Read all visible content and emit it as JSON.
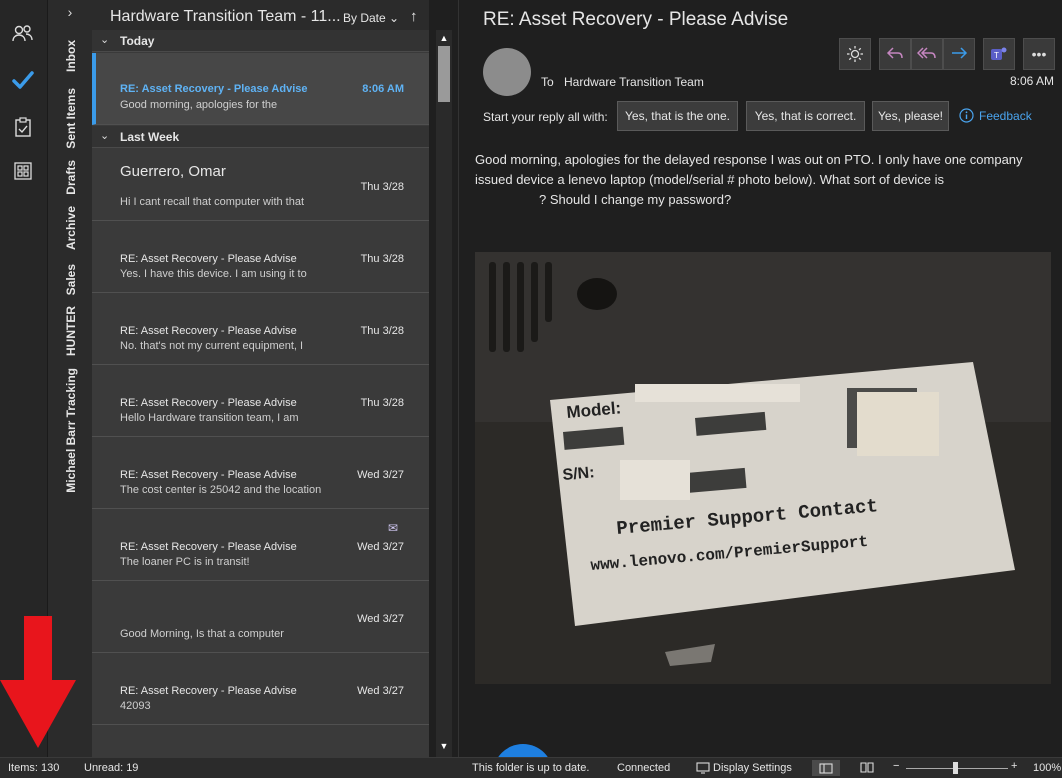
{
  "rail": {
    "icons": [
      "people-icon",
      "todo-check-icon",
      "tasks-clipboard-icon",
      "apps-grid-icon"
    ]
  },
  "folders": [
    "Inbox",
    "Sent Items",
    "Drafts",
    "Archive",
    "Sales",
    "HUNTER",
    "Michael Barr Tracking"
  ],
  "list": {
    "title": "Hardware Transition Team - 11...",
    "sort_label": "By Date",
    "groups": {
      "today": "Today",
      "last_week": "Last Week"
    },
    "items": [
      {
        "sender": "",
        "subject": "RE: Asset Recovery - Please Advise",
        "preview": "Good morning, apologies for the",
        "date": "8:06 AM"
      },
      {
        "sender": "Guerrero, Omar",
        "subject": "",
        "preview": "Hi I cant recall that computer with that",
        "date": "Thu 3/28"
      },
      {
        "sender": "",
        "subject": "RE: Asset Recovery - Please Advise",
        "preview": "Yes. I have this device.  I am using it to",
        "date": "Thu 3/28"
      },
      {
        "sender": "",
        "subject": "RE: Asset Recovery - Please Advise",
        "preview": "No. that's not my current equipment,  I",
        "date": "Thu 3/28"
      },
      {
        "sender": "",
        "subject": "RE: Asset Recovery - Please Advise",
        "preview": "Hello Hardware transition team, I am",
        "date": "Thu 3/28"
      },
      {
        "sender": "",
        "subject": "RE: Asset Recovery - Please Advise",
        "preview": "The cost center is 25042 and the location",
        "date": "Wed 3/27"
      },
      {
        "sender": "",
        "subject": "RE: Asset Recovery - Please Advise",
        "preview": "The loaner PC is in transit!",
        "date": "Wed 3/27"
      },
      {
        "sender": "",
        "subject": "",
        "preview": "Good Morning,  Is that a computer",
        "date": "Wed 3/27"
      },
      {
        "sender": "",
        "subject": "RE: Asset Recovery - Please Advise",
        "preview": "42093",
        "date": "Wed 3/27"
      }
    ]
  },
  "reading": {
    "subject": "RE: Asset Recovery - Please Advise",
    "to_label": "To",
    "to_name": "Hardware Transition Team",
    "time": "8:06 AM",
    "reply_prompt": "Start your reply all with:",
    "quick_replies": [
      "Yes, that is the one.",
      "Yes, that is correct.",
      "Yes, please!"
    ],
    "feedback": "Feedback",
    "body_line1": "Good morning, apologies for the delayed response I was out on PTO.  I only have one company",
    "body_line2": "issued device a lenevo laptop (model/serial # photo below).   What sort of device is",
    "body_line3": "?  Should I change my password?",
    "photo": {
      "model_label": "Model:",
      "sn_label": "S/N:",
      "support_line": "Premier Support Contact",
      "url_line": "www.lenovo.com/PremierSupport"
    }
  },
  "status": {
    "items": "Items: 130",
    "unread": "Unread: 19",
    "folder_state": "This folder is up to date.",
    "connection": "Connected",
    "display_settings": "Display Settings",
    "zoom": "100%"
  },
  "colors": {
    "accent": "#3b9be9",
    "selected_text": "#5fb3f5",
    "annotation_arrow": "#e8151c"
  }
}
